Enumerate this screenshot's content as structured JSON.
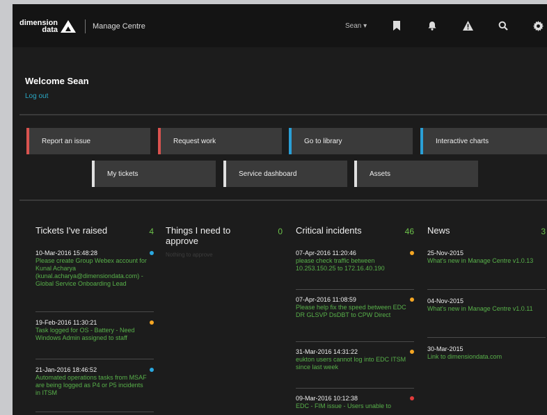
{
  "header": {
    "logo_line1": "dimension",
    "logo_line2": "data",
    "app_title": "Manage Centre",
    "user_menu": "Sean ▾"
  },
  "welcome": {
    "title": "Welcome Sean",
    "logout": "Log out"
  },
  "tiles": [
    {
      "label": "Report an issue",
      "accent": "#d9534f"
    },
    {
      "label": "Request work",
      "accent": "#d9534f"
    },
    {
      "label": "Go to library",
      "accent": "#2a9fd6"
    },
    {
      "label": "Interactive charts",
      "accent": "#2a9fd6"
    },
    {
      "label": "My tickets",
      "accent": "#e0e0e0"
    },
    {
      "label": "Service dashboard",
      "accent": "#e0e0e0"
    },
    {
      "label": "Assets",
      "accent": "#e0e0e0"
    }
  ],
  "columns": {
    "tickets": {
      "title": "Tickets I've raised",
      "count": "4",
      "items": [
        {
          "date": "10-Mar-2016 15:48:28",
          "text": "Please create Group Webex account for Kunal Acharya (kunal.acharya@dimensiondata.com) - Global Service Onboarding Lead"
        },
        {
          "date": "19-Feb-2016 11:30:21",
          "text": "Task logged for OS - Battery - Need Windows Admin assigned to staff"
        },
        {
          "date": "21-Jan-2016 18:46:52",
          "text": "Automated operations tasks from MSAF are being logged as P4 or P5 incidents in ITSM"
        }
      ]
    },
    "approve": {
      "title": "Things I need to approve",
      "count": "0",
      "placeholder": "Nothing to approve"
    },
    "incidents": {
      "title": "Critical incidents",
      "count": "46",
      "items": [
        {
          "date": "07-Apr-2016 11:20:46",
          "text": "please check traffic between 10.253.150.25 to 172.16.40.190"
        },
        {
          "date": "07-Apr-2016 11:08:59",
          "text": "Please help fix the speed between EDC DR GLSVP DsDBT to CPW Direct"
        },
        {
          "date": "31-Mar-2016 14:31:22",
          "text": "eukton users cannot log into EDC ITSM since last week"
        },
        {
          "date": "09-Mar-2016 10:12:38",
          "text": "EDC - FIM issue - Users unable to"
        }
      ]
    },
    "news": {
      "title": "News",
      "count": "3",
      "items": [
        {
          "date": "25-Nov-2015",
          "text": "What's new in Manage Centre v1.0.13"
        },
        {
          "date": "04-Nov-2015",
          "text": "What's new in Manage Centre v1.0.11"
        },
        {
          "date": "30-Mar-2015",
          "text": "Link to dimensiondata.com"
        }
      ]
    }
  },
  "colors": {
    "accent_green": "#58b14a",
    "accent_blue": "#2aa8c4",
    "dot_blue": "#2aa8e0",
    "dot_orange": "#f5a623",
    "dot_red": "#e23b3b"
  }
}
